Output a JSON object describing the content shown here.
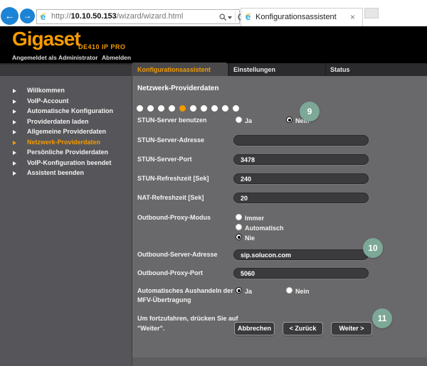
{
  "browser": {
    "url_prefix": "http://",
    "url_host": "10.10.50.153",
    "url_path": "/wizard/wizard.html",
    "tab_title": "Konfigurationsassistent",
    "close_glyph": "×",
    "back_glyph": "←",
    "forward_glyph": "→"
  },
  "header": {
    "brand": "Gigaset",
    "model": "DE410 IP PRO",
    "login_status": "Angemeldet als Administrator",
    "logout_label": "Abmelden"
  },
  "nav_tabs": {
    "items": [
      {
        "label": "Konfigurationsassistent",
        "active": true
      },
      {
        "label": "Einstellungen",
        "active": false
      },
      {
        "label": "Status",
        "active": false
      }
    ]
  },
  "sidebar": {
    "items": [
      {
        "label": "Willkommen",
        "active": false
      },
      {
        "label": "VoIP-Account",
        "active": false
      },
      {
        "label": "Automatische Konfiguration",
        "active": false
      },
      {
        "label": "Providerdaten laden",
        "active": false
      },
      {
        "label": "Allgemeine Providerdaten",
        "active": false
      },
      {
        "label": "Netzwerk-Providerdaten",
        "active": true
      },
      {
        "label": "Persönliche Providerdaten",
        "active": false
      },
      {
        "label": "VoIP-Konfiguration beendet",
        "active": false
      },
      {
        "label": "Assistent beenden",
        "active": false
      }
    ]
  },
  "wizard": {
    "title": "Netzwerk-Providerdaten",
    "progress": {
      "total": 10,
      "current": 5
    }
  },
  "form": {
    "stun_use": {
      "label": "STUN-Server benutzen",
      "options": [
        "Ja",
        "Nein"
      ],
      "selected": "Nein"
    },
    "stun_address": {
      "label": "STUN-Server-Adresse",
      "value": ""
    },
    "stun_port": {
      "label": "STUN-Server-Port",
      "value": "3478"
    },
    "stun_refresh": {
      "label": "STUN-Refreshzeit [Sek]",
      "value": "240"
    },
    "nat_refresh": {
      "label": "NAT-Refreshzeit [Sek]",
      "value": "20"
    },
    "outbound_mode": {
      "label": "Outbound-Proxy-Modus",
      "options": [
        "Immer",
        "Automatisch",
        "Nie"
      ],
      "selected": "Nie"
    },
    "outbound_address": {
      "label": "Outbound-Server-Adresse",
      "value": "sip.solucon.com"
    },
    "outbound_port": {
      "label": "Outbound-Proxy-Port",
      "value": "5060"
    },
    "dtmf": {
      "label_lines": [
        "Automatisches Aushandeln der",
        "MFV-Übertragung"
      ],
      "options": [
        "Ja",
        "Nein"
      ],
      "selected": "Ja"
    },
    "proceed_note_lines": [
      "Um fortzufahren, drücken Sie auf",
      "\"Weiter\"."
    ],
    "buttons": {
      "cancel": "Abbrechen",
      "back": "< Zurück",
      "next": "Weiter >"
    }
  },
  "annotations": {
    "badge_color": "#7da897",
    "badges": [
      "9",
      "10",
      "11"
    ]
  },
  "colors": {
    "accent_orange": "#f59b00",
    "content_bg": "#69696b",
    "sidebar_bg": "#56565a",
    "input_bg": "#3b3b3e"
  }
}
